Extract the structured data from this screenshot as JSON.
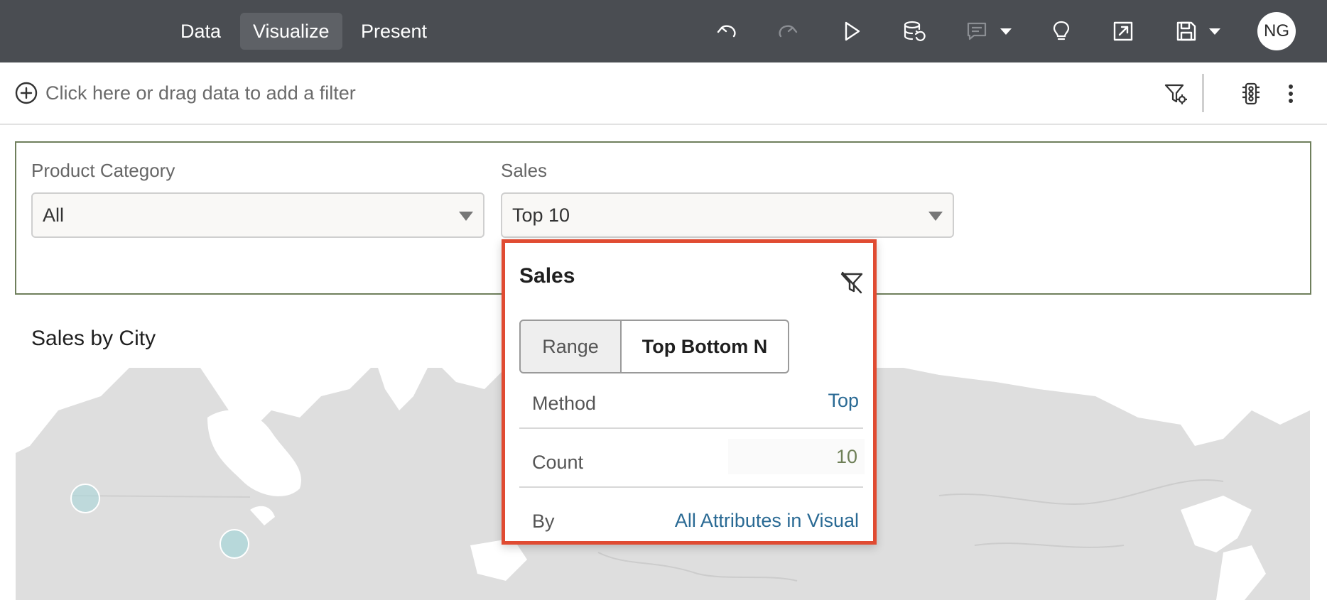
{
  "header": {
    "tabs": [
      {
        "label": "Data"
      },
      {
        "label": "Visualize",
        "active": true
      },
      {
        "label": "Present"
      }
    ],
    "icons": [
      "undo-icon",
      "redo-icon",
      "run-icon",
      "refresh-data-icon",
      "comment-icon",
      "insights-lightbulb-icon",
      "export-icon",
      "save-icon"
    ],
    "avatar_initials": "NG"
  },
  "filter_bar": {
    "placeholder": "Click here or drag data to add a filter"
  },
  "filter_controls": {
    "product_category": {
      "label": "Product Category",
      "value": "All"
    },
    "sales": {
      "label": "Sales",
      "value": "Top 10"
    }
  },
  "visualization": {
    "title": "Sales by City"
  },
  "popup": {
    "title": "Sales",
    "segments": {
      "range": "Range",
      "top_bottom_n": "Top Bottom N"
    },
    "method": {
      "label": "Method",
      "value": "Top"
    },
    "count": {
      "label": "Count",
      "value": "10"
    },
    "by": {
      "label": "By",
      "value": "All Attributes in Visual"
    }
  },
  "colors": {
    "header_bg": "#4a4d52",
    "active_tab_bg": "#5e6166",
    "popup_border": "#e04b32",
    "link_value": "#2a6a94",
    "count_value": "#6e7f57",
    "map_land": "#dedede",
    "map_bubble": "#a9d6d8"
  }
}
